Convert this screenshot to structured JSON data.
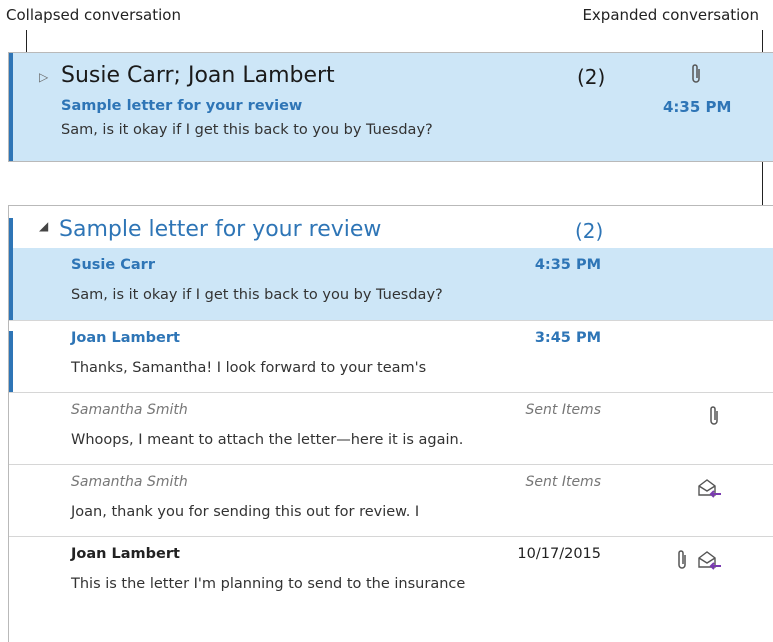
{
  "callouts": {
    "left": "Collapsed conversation",
    "right": "Expanded conversation"
  },
  "collapsed": {
    "senders": "Susie Carr;  Joan Lambert",
    "count": "(2)",
    "subject": "Sample letter for your review",
    "time": "4:35 PM",
    "preview": "Sam, is it okay if I get this back to you by Tuesday?"
  },
  "expanded": {
    "subject": "Sample letter for your review",
    "count": "(2)",
    "messages": [
      {
        "from": "Susie Carr",
        "right": "4:35 PM",
        "preview": "Sam, is it okay if I get this back to you by Tuesday?"
      },
      {
        "from": "Joan Lambert",
        "right": "3:45 PM",
        "preview": "Thanks, Samantha! I look forward to your team's"
      },
      {
        "from": "Samantha Smith",
        "right": "Sent Items",
        "preview": "Whoops, I meant to attach the letter—here it is again."
      },
      {
        "from": "Samantha Smith",
        "right": "Sent Items",
        "preview": "Joan, thank you for sending this out for review. I"
      },
      {
        "from": "Joan Lambert",
        "right": "10/17/2015",
        "preview": "This is the letter I'm planning to send to the insurance"
      }
    ]
  },
  "colors": {
    "accent": "#2e75b6",
    "selected_bg": "#cde6f7",
    "reply_arrow": "#7a3bb0"
  },
  "icons": {
    "attachment": "paperclip-icon",
    "replied": "envelope-replied-icon",
    "expand": "triangle-right-icon",
    "collapse": "triangle-down-icon"
  }
}
